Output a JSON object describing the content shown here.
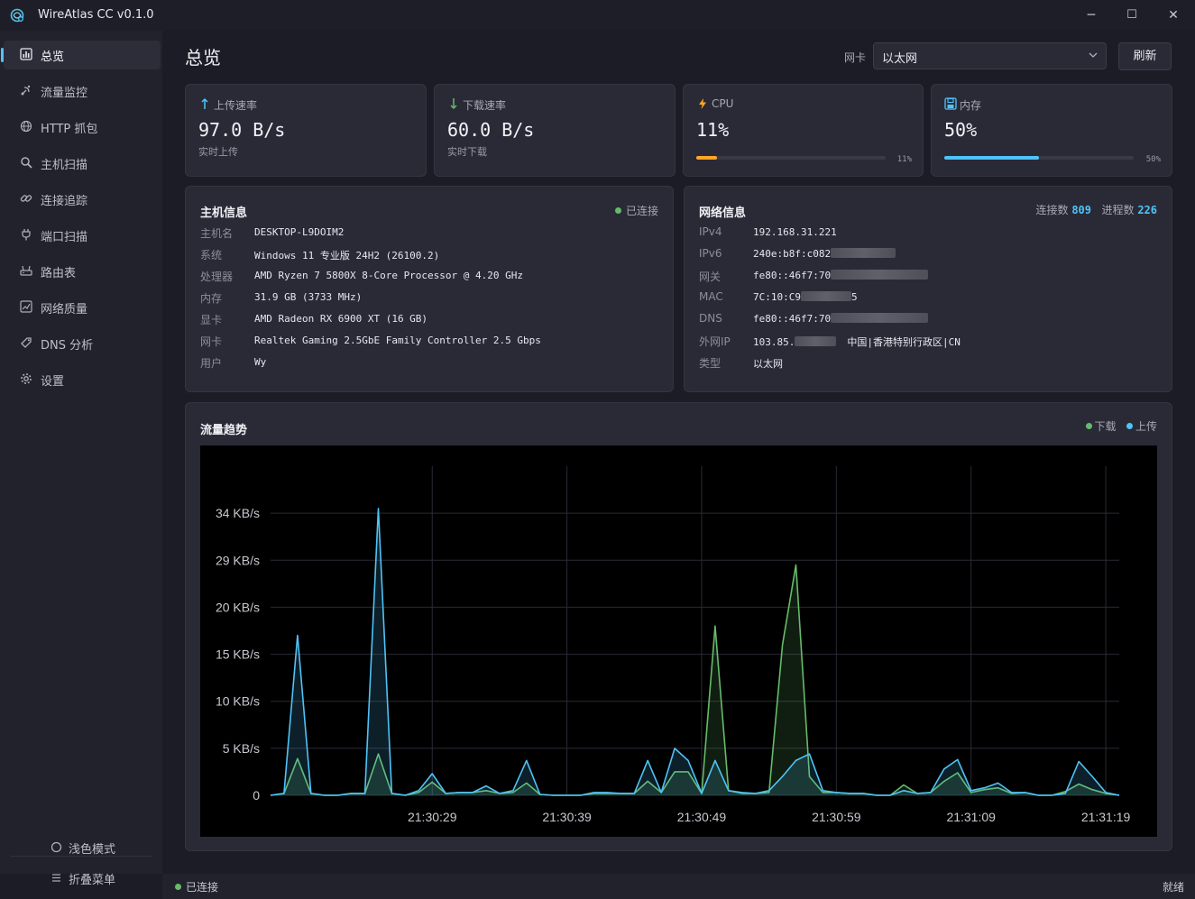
{
  "app": {
    "title": "WireAtlas CC v0.1.0"
  },
  "window_controls": {
    "minimize": "─",
    "maximize": "☐",
    "close": "✕"
  },
  "sidebar": {
    "items": [
      {
        "label": "总览",
        "icon": "chart-icon",
        "active": true
      },
      {
        "label": "流量监控",
        "icon": "satellite-icon"
      },
      {
        "label": "HTTP 抓包",
        "icon": "globe-icon"
      },
      {
        "label": "主机扫描",
        "icon": "magnifier-icon"
      },
      {
        "label": "连接追踪",
        "icon": "link-icon"
      },
      {
        "label": "端口扫描",
        "icon": "plug-icon"
      },
      {
        "label": "路由表",
        "icon": "router-icon"
      },
      {
        "label": "网络质量",
        "icon": "chart-line-icon"
      },
      {
        "label": "DNS 分析",
        "icon": "tag-icon"
      },
      {
        "label": "设置",
        "icon": "gear-icon"
      }
    ],
    "light_mode": "浅色模式",
    "collapse_menu": "折叠菜单"
  },
  "header": {
    "page_title": "总览",
    "nic_label": "网卡",
    "nic_value": "以太网",
    "refresh_label": "刷新"
  },
  "stats": {
    "upload": {
      "title": "上传速率",
      "value": "97.0 B/s",
      "sub": "实时上传",
      "icon": "arrow-up-icon"
    },
    "download": {
      "title": "下载速率",
      "value": "60.0 B/s",
      "sub": "实时下载",
      "icon": "arrow-down-icon"
    },
    "cpu": {
      "title": "CPU",
      "value": "11%",
      "percent": 11,
      "percent_label": "11%",
      "color": "#ffa726",
      "icon": "lightning-icon"
    },
    "memory": {
      "title": "内存",
      "value": "50%",
      "percent": 50,
      "percent_label": "50%",
      "color": "#4fc3f7",
      "icon": "floppy-icon"
    }
  },
  "host_info": {
    "title": "主机信息",
    "status": "已连接",
    "status_color": "#66bb6a",
    "rows": [
      {
        "key": "主机名",
        "value": "DESKTOP-L9DOIM2"
      },
      {
        "key": "系统",
        "value": "Windows 11 专业版 24H2 (26100.2)"
      },
      {
        "key": "处理器",
        "value": "AMD Ryzen 7 5800X 8-Core Processor @ 4.20 GHz"
      },
      {
        "key": "内存",
        "value": "31.9 GB (3733 MHz)"
      },
      {
        "key": "显卡",
        "value": "AMD Radeon RX 6900 XT (16 GB)"
      },
      {
        "key": "网卡",
        "value": "Realtek Gaming 2.5GbE Family Controller  2.5 Gbps"
      },
      {
        "key": "用户",
        "value": "Wy"
      }
    ]
  },
  "network_info": {
    "title": "网络信息",
    "connections_label": "连接数",
    "connections": "809",
    "processes_label": "进程数",
    "processes": "226",
    "rows": [
      {
        "key": "IPv4",
        "value": "192.168.31.221",
        "suffix": ""
      },
      {
        "key": "IPv6",
        "value": "240e:b8f:c082",
        "suffix": ""
      },
      {
        "key": "网关",
        "value": "fe80::46f7:70",
        "suffix": ""
      },
      {
        "key": "MAC",
        "value": "7C:10:C9",
        "suffix": "5"
      },
      {
        "key": "DNS",
        "value": "fe80::46f7:70",
        "suffix": ""
      },
      {
        "key": "外网IP",
        "value": "103.85.",
        "suffix": "中国|香港特别行政区|CN"
      },
      {
        "key": "类型",
        "value": "以太网",
        "suffix": ""
      }
    ]
  },
  "traffic": {
    "title": "流量趋势",
    "legend_download": "下载",
    "legend_upload": "上传",
    "download_color": "#66bb6a",
    "upload_color": "#4fc3f7"
  },
  "chart_data": {
    "type": "area",
    "title": "流量趋势",
    "yunit": "KB/s",
    "ylim": [
      0,
      35
    ],
    "yticks": [
      0,
      5,
      10,
      15,
      20,
      25,
      30
    ],
    "ytick_labels": [
      "0",
      "5 KB/s",
      "10 KB/s",
      "15 KB/s",
      "20 KB/s",
      "29 KB/s",
      "34 KB/s"
    ],
    "xlim": [
      17,
      76
    ],
    "xticks": [
      29,
      39,
      49,
      59,
      69,
      79
    ],
    "xtick_labels": [
      "21:30:29",
      "21:30:39",
      "21:30:49",
      "21:30:59",
      "21:31:09",
      "21:31:19"
    ],
    "grid": true,
    "legend_position": "top-right",
    "series": [
      {
        "name": "上传",
        "color": "#4fc3f7",
        "points": [
          [
            17,
            0
          ],
          [
            18,
            0.2
          ],
          [
            19,
            17
          ],
          [
            20,
            0.2
          ],
          [
            21,
            0
          ],
          [
            22,
            0
          ],
          [
            23,
            0.2
          ],
          [
            24,
            0.2
          ],
          [
            25,
            30.5
          ],
          [
            26,
            0.2
          ],
          [
            27,
            0
          ],
          [
            28,
            0.5
          ],
          [
            29,
            2.3
          ],
          [
            30,
            0.2
          ],
          [
            31,
            0.3
          ],
          [
            32,
            0.3
          ],
          [
            33,
            1.0
          ],
          [
            34,
            0.2
          ],
          [
            35,
            0.5
          ],
          [
            36,
            3.7
          ],
          [
            37,
            0.1
          ],
          [
            38,
            0
          ],
          [
            39,
            0
          ],
          [
            40,
            0
          ],
          [
            41,
            0.3
          ],
          [
            42,
            0.3
          ],
          [
            43,
            0.2
          ],
          [
            44,
            0.2
          ],
          [
            45,
            3.7
          ],
          [
            46,
            0.3
          ],
          [
            47,
            5.0
          ],
          [
            48,
            3.7
          ],
          [
            49,
            0.2
          ],
          [
            50,
            3.7
          ],
          [
            51,
            0.5
          ],
          [
            52,
            0.3
          ],
          [
            53,
            0.2
          ],
          [
            54,
            0.5
          ],
          [
            55,
            2.0
          ],
          [
            56,
            3.7
          ],
          [
            57,
            4.4
          ],
          [
            58,
            0.5
          ],
          [
            59,
            0.3
          ],
          [
            60,
            0.2
          ],
          [
            61,
            0.2
          ],
          [
            62,
            0
          ],
          [
            63,
            0
          ],
          [
            64,
            0.5
          ],
          [
            65,
            0.2
          ],
          [
            66,
            0.3
          ],
          [
            67,
            2.8
          ],
          [
            68,
            3.8
          ],
          [
            69,
            0.5
          ],
          [
            70,
            0.8
          ],
          [
            71,
            1.3
          ],
          [
            72,
            0.3
          ],
          [
            73,
            0.3
          ],
          [
            74,
            0
          ],
          [
            75,
            0
          ],
          [
            76,
            0.2
          ],
          [
            77,
            3.6
          ],
          [
            78,
            2.0
          ],
          [
            79,
            0.3
          ],
          [
            80,
            0
          ]
        ]
      },
      {
        "name": "下载",
        "color": "#66bb6a",
        "points": [
          [
            17,
            0
          ],
          [
            18,
            0.2
          ],
          [
            19,
            3.9
          ],
          [
            20,
            0.2
          ],
          [
            21,
            0
          ],
          [
            22,
            0
          ],
          [
            23,
            0.2
          ],
          [
            24,
            0.2
          ],
          [
            25,
            4.4
          ],
          [
            26,
            0.2
          ],
          [
            27,
            0
          ],
          [
            28,
            0.3
          ],
          [
            29,
            1.4
          ],
          [
            30,
            0.2
          ],
          [
            31,
            0.3
          ],
          [
            32,
            0.3
          ],
          [
            33,
            0.5
          ],
          [
            34,
            0.2
          ],
          [
            35,
            0.3
          ],
          [
            36,
            1.3
          ],
          [
            37,
            0.1
          ],
          [
            38,
            0
          ],
          [
            39,
            0
          ],
          [
            40,
            0
          ],
          [
            41,
            0.2
          ],
          [
            42,
            0.2
          ],
          [
            43,
            0.2
          ],
          [
            44,
            0.2
          ],
          [
            45,
            1.5
          ],
          [
            46,
            0.3
          ],
          [
            47,
            2.5
          ],
          [
            48,
            2.5
          ],
          [
            49,
            0.2
          ],
          [
            50,
            18
          ],
          [
            51,
            0.5
          ],
          [
            52,
            0.2
          ],
          [
            53,
            0.2
          ],
          [
            54,
            0.3
          ],
          [
            55,
            16
          ],
          [
            56,
            24.5
          ],
          [
            57,
            2.0
          ],
          [
            58,
            0.3
          ],
          [
            59,
            0.3
          ],
          [
            60,
            0.2
          ],
          [
            61,
            0.2
          ],
          [
            62,
            0
          ],
          [
            63,
            0
          ],
          [
            64,
            1.1
          ],
          [
            65,
            0.2
          ],
          [
            66,
            0.3
          ],
          [
            67,
            1.5
          ],
          [
            68,
            2.4
          ],
          [
            69,
            0.3
          ],
          [
            70,
            0.6
          ],
          [
            71,
            0.8
          ],
          [
            72,
            0.2
          ],
          [
            73,
            0.3
          ],
          [
            74,
            0
          ],
          [
            75,
            0
          ],
          [
            76,
            0.4
          ],
          [
            77,
            1.2
          ],
          [
            78,
            0.6
          ],
          [
            79,
            0.2
          ],
          [
            80,
            0
          ]
        ]
      }
    ]
  },
  "status_bar": {
    "left": "已连接",
    "right": "就绪"
  }
}
